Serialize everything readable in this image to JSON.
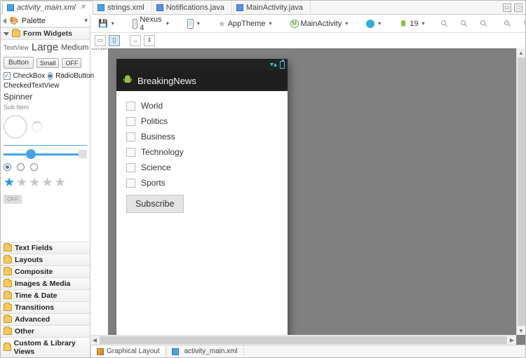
{
  "tabs": {
    "items": [
      {
        "label": "activity_main.xml",
        "type": "xml"
      },
      {
        "label": "strings.xml",
        "type": "xml"
      },
      {
        "label": "Notifications.java",
        "type": "java"
      },
      {
        "label": "MainActivity.java",
        "type": "java"
      }
    ],
    "active": 0
  },
  "palette": {
    "header": "Palette",
    "form_widgets_label": "Form Widgets",
    "textview_label": "TextView",
    "large_label": "Large",
    "medium_label": "Medium",
    "small_label": "Small",
    "button_label": "Button",
    "small_btn_label": "Small",
    "off_btn_label": "OFF",
    "checkbox_label": "CheckBox",
    "radiobutton_label": "RadioButton",
    "checked_textview_label": "CheckedTextView",
    "spinner_label": "Spinner",
    "sub_item_label": "Sub Item",
    "toggle_off": "OFF",
    "categories": [
      "Text Fields",
      "Layouts",
      "Composite",
      "Images & Media",
      "Time & Date",
      "Transitions",
      "Advanced",
      "Other",
      "Custom & Library Views"
    ]
  },
  "toolbar": {
    "device": "Nexus 4",
    "theme": "AppTheme",
    "activity": "MainActivity",
    "api": "19"
  },
  "preview": {
    "app_title": "BreakingNews",
    "checkboxes": [
      "World",
      "Politics",
      "Business",
      "Technology",
      "Science",
      "Sports"
    ],
    "subscribe": "Subscribe"
  },
  "bottom_tabs": {
    "graphical": "Graphical Layout",
    "file": "activity_main.xml"
  }
}
